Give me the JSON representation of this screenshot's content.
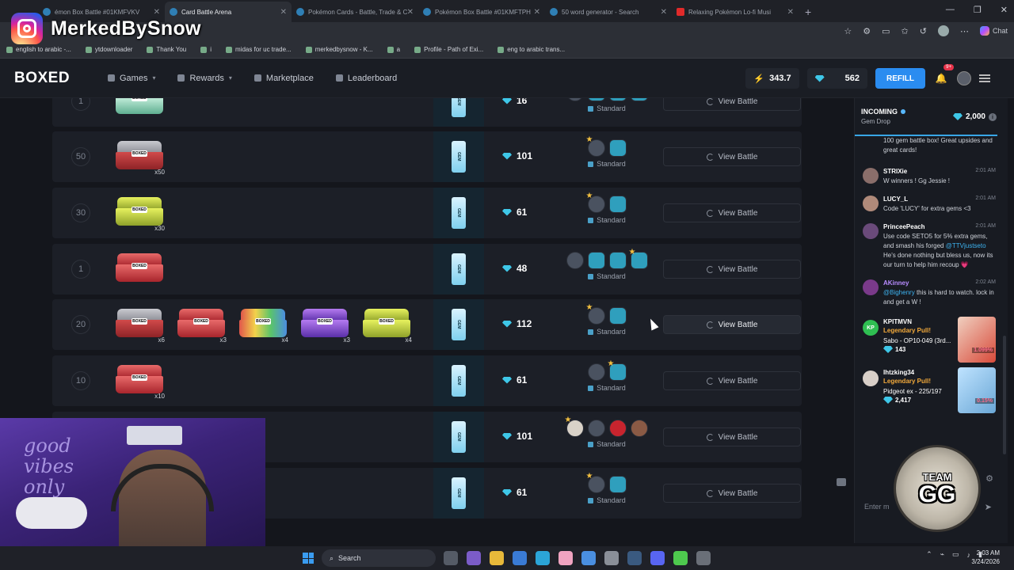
{
  "overlay": {
    "instagram_handle": "MerkedBySnow"
  },
  "browser": {
    "tabs": [
      {
        "title": "émon Box Battle #01KMFVKV",
        "active": false,
        "icon": "box-icon"
      },
      {
        "title": "Card Battle Arena",
        "active": true,
        "icon": "box-icon"
      },
      {
        "title": "Pokémon Cards - Battle, Trade & C",
        "active": false,
        "icon": "box-icon"
      },
      {
        "title": "Pokémon Box Battle #01KMFTPH",
        "active": false,
        "icon": "box-icon"
      },
      {
        "title": "50 word generator - Search",
        "active": false,
        "icon": "search-icon"
      },
      {
        "title": "Relaxing Pokémon Lo-fi Musi",
        "active": false,
        "icon": "youtube-icon"
      }
    ],
    "chat_label": "Chat",
    "bookmarks": [
      "english to arabic -...",
      "ytdownloader",
      "Thank You",
      "i",
      "midas for uc trade...",
      "merkedbysnow - K...",
      "a",
      "Profile - Path of Exi...",
      "eng to arabic trans..."
    ]
  },
  "site": {
    "logo": "BOXED",
    "nav": [
      {
        "label": "Games",
        "dropdown": true,
        "icon": "gamepad-icon"
      },
      {
        "label": "Rewards",
        "dropdown": true,
        "icon": "gift-icon"
      },
      {
        "label": "Marketplace",
        "dropdown": false,
        "icon": "store-icon"
      },
      {
        "label": "Leaderboard",
        "dropdown": false,
        "icon": "trophy-icon"
      }
    ],
    "energy": "343.7",
    "gems": "562",
    "refill_label": "REFILL",
    "notif_badge": "9+"
  },
  "battles": [
    {
      "rounds": "1",
      "boxes": [
        {
          "color": "teal",
          "qty": ""
        }
      ],
      "cost": "16",
      "players": [
        "star",
        "bot",
        "bot",
        "bot"
      ],
      "type": "Standard",
      "action": "View Battle"
    },
    {
      "rounds": "50",
      "boxes": [
        {
          "color": "redgray",
          "qty": "x50"
        }
      ],
      "cost": "101",
      "players": [
        "star",
        "bot"
      ],
      "type": "Standard",
      "action": "View Battle"
    },
    {
      "rounds": "30",
      "boxes": [
        {
          "color": "yellow",
          "qty": "x30"
        }
      ],
      "cost": "61",
      "players": [
        "star",
        "bot"
      ],
      "type": "Standard",
      "action": "View Battle"
    },
    {
      "rounds": "1",
      "boxes": [
        {
          "color": "red",
          "qty": ""
        }
      ],
      "cost": "48",
      "players": [
        "plain",
        "bot",
        "bot",
        "starbot"
      ],
      "type": "Standard",
      "action": "View Battle"
    },
    {
      "rounds": "20",
      "boxes": [
        {
          "color": "redgray",
          "qty": "x6"
        },
        {
          "color": "red",
          "qty": "x3"
        },
        {
          "color": "rainbow",
          "qty": "x4"
        },
        {
          "color": "purple",
          "qty": "x3"
        },
        {
          "color": "yellow",
          "qty": "x4"
        }
      ],
      "cost": "112",
      "players": [
        "star",
        "bot"
      ],
      "type": "Standard",
      "action": "View Battle"
    },
    {
      "rounds": "10",
      "boxes": [
        {
          "color": "red",
          "qty": "x10"
        }
      ],
      "cost": "61",
      "players": [
        "plain",
        "starbot"
      ],
      "type": "Standard",
      "action": "View Battle"
    },
    {
      "rounds": "",
      "boxes": [],
      "cost": "101",
      "players": [
        "starlight",
        "plain",
        "red",
        "brown"
      ],
      "type": "Standard",
      "action": "View Battle"
    },
    {
      "rounds": "",
      "boxes": [],
      "cost": "61",
      "players": [
        "star",
        "bot"
      ],
      "type": "Standard",
      "action": "View Battle"
    }
  ],
  "mode_card_label": "GEM",
  "box_tag": "BOXED",
  "panel": {
    "incoming_title": "INCOMING",
    "incoming_sub": "Gem Drop",
    "incoming_amount": "2,000",
    "top_message": "100 gem battle box! Great upsides and great cards!",
    "messages": [
      {
        "name": "STRIXie",
        "time": "2:01 AM",
        "text": "W winners ! Gg Jessie !"
      },
      {
        "name": "LUCY_L",
        "time": "2:01 AM",
        "text": "Code 'LUCY' for extra gems <3"
      },
      {
        "name": "PrinceePeach",
        "time": "2:01 AM",
        "text": "Use code SETO5 for 5% extra gems, and smash his forged",
        "mention": "@TTVjustseto",
        "text2": "He's done nothing but bless us, now its our turn to help him recoup 💗"
      },
      {
        "name": "AKinney",
        "time": "2:02 AM",
        "mention": "@Bighenry",
        "text": "this is hard to watch. lock in and get a W !"
      }
    ],
    "pulls": [
      {
        "user": "KPITMVN",
        "avatar": "KP",
        "rarity": "Legendary Pull!",
        "card": "Sabo - OP10-049 (3rd...",
        "value": "143",
        "pct": "1.099%"
      },
      {
        "user": "Ihtzking34",
        "avatar": "",
        "rarity": "Legendary Pull!",
        "card": "Pidgeot ex - 225/197",
        "value": "2,417",
        "pct": "0.15%"
      }
    ],
    "input_placeholder": "Enter m"
  },
  "stream_overlay": {
    "team_line1": "TEAM",
    "team_line2": "GG"
  },
  "webcam": {
    "sign_text": "good vibes only"
  },
  "taskbar": {
    "search_label": "Search",
    "time": "2:03 AM",
    "date": "3/24/2026"
  }
}
